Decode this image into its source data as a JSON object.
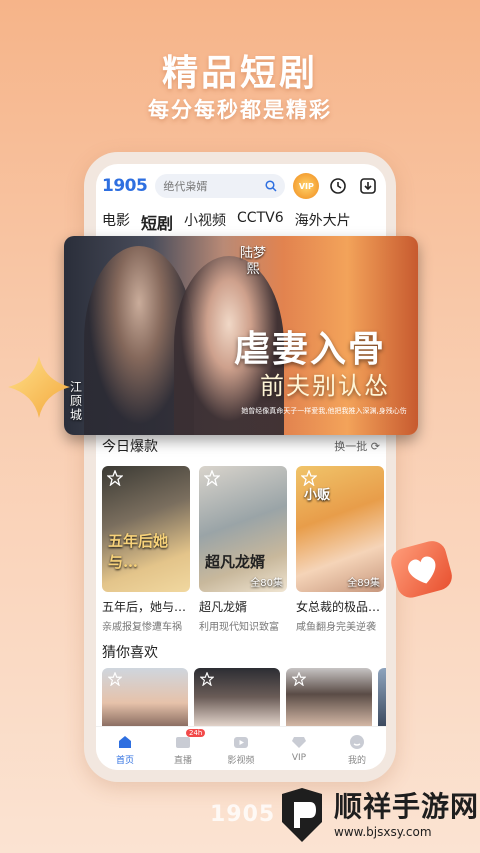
{
  "headline": {
    "title": "精品短剧",
    "subtitle": "每分每秒都是精彩"
  },
  "app": {
    "logo": "1905",
    "search_placeholder": "绝代枭婿",
    "vip_badge": "VIP",
    "tabs": [
      {
        "label": "电影",
        "active": false
      },
      {
        "label": "短剧",
        "active": true
      },
      {
        "label": "小视频",
        "active": false
      },
      {
        "label": "CCTV6",
        "active": false
      },
      {
        "label": "海外大片",
        "active": false
      }
    ]
  },
  "banner": {
    "title_line1": "虐妻入骨",
    "title_line2": "前夫别认怂",
    "actor_right": "陆梦熙",
    "actor_left": "江顾城",
    "caption": "她曾经像真命天子一样爱我,他把我推入深渊,身残心伤"
  },
  "today_hot": {
    "title": "今日爆款",
    "action": "换一批",
    "items": [
      {
        "poster_text": "五年后她与…",
        "name": "五年后，她与…",
        "desc": "亲戚报复惨遭车祸",
        "episodes": ""
      },
      {
        "poster_text": "超凡龙婿",
        "name": "超凡龙婿",
        "desc": "利用现代知识致富",
        "episodes": "全80集"
      },
      {
        "poster_text": "小贩",
        "name": "女总裁的极品…",
        "desc": "咸鱼翻身完美逆袭",
        "episodes": "全89集"
      }
    ]
  },
  "guess": {
    "title": "猜你喜欢"
  },
  "bottom_nav": [
    {
      "label": "首页",
      "active": true,
      "icon": "home-icon"
    },
    {
      "label": "直播",
      "active": false,
      "icon": "live-icon",
      "badge": "24h"
    },
    {
      "label": "影视频",
      "active": false,
      "icon": "video-icon"
    },
    {
      "label": "VIP",
      "active": false,
      "icon": "diamond-icon"
    },
    {
      "label": "我的",
      "active": false,
      "icon": "profile-icon"
    }
  ],
  "footer_logo": "1905",
  "watermark": {
    "title": "顺祥手游网",
    "url": "www.bjsxsy.com"
  },
  "colors": {
    "brand_blue": "#2e6fe0",
    "background_peach": "#f6b489"
  }
}
